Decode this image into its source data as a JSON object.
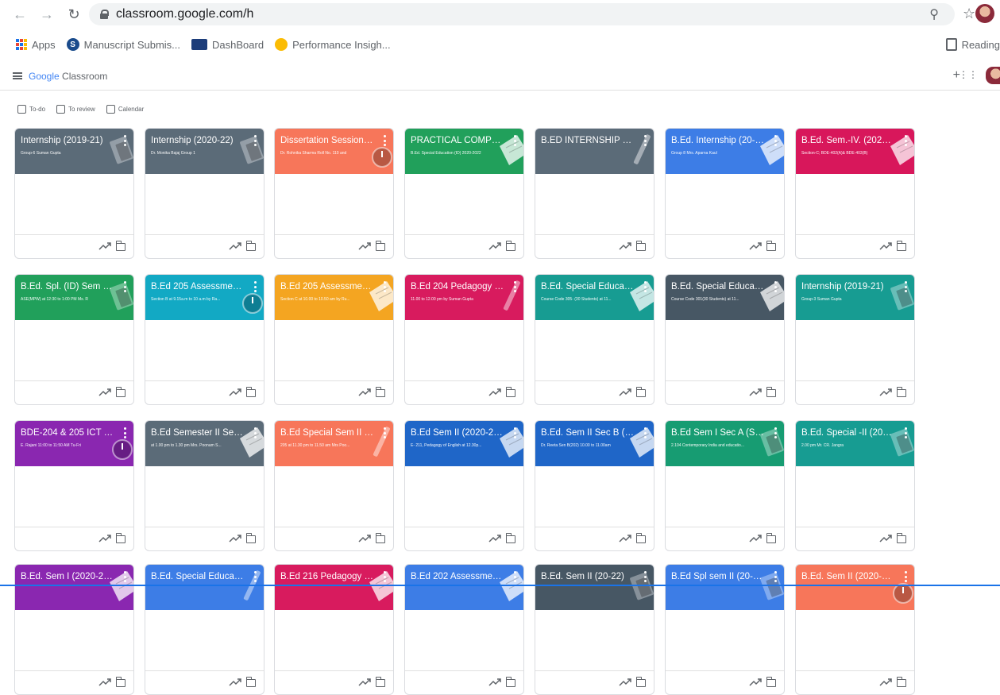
{
  "browser": {
    "url": "classroom.google.com/h",
    "bookmarks": [
      {
        "label": "Apps",
        "icon": "apps-grid-icon"
      },
      {
        "label": "Manuscript Submis...",
        "icon": "s-logo-icon"
      },
      {
        "label": "DashBoard",
        "icon": "dashboard-icon"
      },
      {
        "label": "Performance Insigh...",
        "icon": "performance-icon"
      }
    ],
    "reading_list": "Reading"
  },
  "app": {
    "brand_google": "Google",
    "brand_product": " Classroom"
  },
  "subnav": {
    "todo": "To-do",
    "to_review": "To review",
    "calendar": "Calendar"
  },
  "colors": {
    "slate": "#536471",
    "teal": "#12a6a6",
    "orange": "#f7765a",
    "green": "#1e9e5a",
    "blue": "#3a7be8",
    "magenta": "#d5175d",
    "purple": "#8a27b0",
    "amber": "#f1a51d",
    "darkslate": "#475764",
    "navy": "#1f66c8",
    "pink": "#d31c5c"
  },
  "courses": [
    {
      "title": "Internship (2019-21)",
      "subtitle": "Group-6 Suman Gupta",
      "color": "#5b6b78"
    },
    {
      "title": "Internship (2020-22)",
      "subtitle": "Dr. Monika Bajaj Group 1",
      "color": "#5b6b78"
    },
    {
      "title": "Dissertation Session (...",
      "subtitle": "Dr. Rohnika Sharma Roll No. 110 and",
      "color": "#f7765a"
    },
    {
      "title": "PRACTICAL COMPO...",
      "subtitle": "B.Ed. Special Education (ID) 2020-2022",
      "color": "#21a05b"
    },
    {
      "title": "B.ED INTERNSHIP SES...",
      "subtitle": "",
      "color": "#5b6b78"
    },
    {
      "title": "B.Ed. Internship (20-2...",
      "subtitle": "Group 8 Mrs. Aparna Kaul",
      "color": "#3d7de6"
    },
    {
      "title": "B.Ed. Sem.-IV. (2020-...",
      "subtitle": "Section-C; BDE-402(A)& BDE-403(B)",
      "color": "#d8175b"
    },
    {
      "title": "B.Ed. Spl. (ID) Sem IV ...",
      "subtitle": "ASE(MPW) at 12:30 to 1:00 PM Ms. R",
      "color": "#21a05b"
    },
    {
      "title": "B.Ed 205 Assessment...",
      "subtitle": "Section B at 9.15a.m to 10 a.m by Ra...",
      "color": "#12a9c4"
    },
    {
      "title": "B.Ed 205 Assessment...",
      "subtitle": "Section C at 10.00 to 10.50 am by Ru...",
      "color": "#f4a521"
    },
    {
      "title": "B.Ed 204 Pedagogy o...",
      "subtitle": "11.00 to 12.00 pm by Suman Gupta",
      "color": "#d81b5e"
    },
    {
      "title": "B.Ed. Special Educati...",
      "subtitle": "Course Code 305- (30 Students) at 11...",
      "color": "#179c92"
    },
    {
      "title": "B.Ed. Special Educati...",
      "subtitle": "Course Code 301(30 Students) at 11...",
      "color": "#475764"
    },
    {
      "title": "Internship (2019-21)",
      "subtitle": "Group-3 Suman Gupta",
      "color": "#179c92"
    },
    {
      "title": "BDE-204 & 205 ICT in...",
      "subtitle": "E. Rajani 11:00 to 11:50 AM Tu-Fri",
      "color": "#8a27b0"
    },
    {
      "title": "B.Ed Semester II Sess...",
      "subtitle": "at 1.00 pm to 1.30 pm Mrs. Poonam S...",
      "color": "#5b6b78"
    },
    {
      "title": "B.Ed Special Sem II (2...",
      "subtitle": "205 at 11.30 pm to 11.50 am Mrs Poo...",
      "color": "#f7765a"
    },
    {
      "title": "B.Ed Sem II (2020-20...",
      "subtitle": "E- 211, Pedagogy of English at 12.30p...",
      "color": "#1f66c8"
    },
    {
      "title": "B.Ed. Sem II Sec B (20...",
      "subtitle": "Dr. Reeta Sen B(202) 10.00 to 11.00am",
      "color": "#1f66c8"
    },
    {
      "title": "B.Ed Sem I Sec A (Ses...",
      "subtitle": "2.104 Contemporary India and educatio...",
      "color": "#179c72"
    },
    {
      "title": "B.Ed. Special -II (204)...",
      "subtitle": "2.00 pm Mr. CR. Jangra",
      "color": "#179c92"
    },
    {
      "title": "B.Ed. Sem I (2020-20...",
      "subtitle": "",
      "color": "#8a27b0"
    },
    {
      "title": "B.Ed. Special Educati...",
      "subtitle": "",
      "color": "#3d7de6"
    },
    {
      "title": "B.Ed 216 Pedagogy of...",
      "subtitle": "",
      "color": "#d81b5e"
    },
    {
      "title": "B.Ed 202 Assessment...",
      "subtitle": "",
      "color": "#3d7de6"
    },
    {
      "title": "B.Ed. Sem II (20-22)",
      "subtitle": "",
      "color": "#475764"
    },
    {
      "title": "B.Ed Spl sem II (20-22)",
      "subtitle": "",
      "color": "#3d7de6"
    },
    {
      "title": "B.Ed. Sem II (2020-20...",
      "subtitle": "",
      "color": "#f7765a"
    }
  ]
}
